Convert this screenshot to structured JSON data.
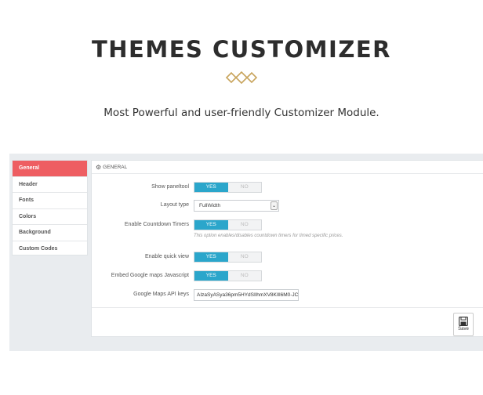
{
  "hero": {
    "title": "THEMES CUSTOMIZER",
    "subtitle": "Most Powerful and user-friendly Customizer Module."
  },
  "colors": {
    "accent_active_tab": "#ee5e62",
    "toggle_on": "#2ba6cb",
    "ornament": "#c8a45c"
  },
  "sidebar": {
    "items": [
      {
        "label": "General",
        "active": true
      },
      {
        "label": "Header",
        "active": false
      },
      {
        "label": "Fonts",
        "active": false
      },
      {
        "label": "Colors",
        "active": false
      },
      {
        "label": "Background",
        "active": false
      },
      {
        "label": "Custom Codes",
        "active": false
      }
    ]
  },
  "panel": {
    "heading_icon": "cog-icon",
    "heading": "GENERAL",
    "fields": {
      "show_paneltool": {
        "label": "Show paneltool",
        "yes": "YES",
        "no": "NO",
        "value": "YES"
      },
      "layout_type": {
        "label": "Layout type",
        "value": "FullWidth"
      },
      "countdown": {
        "label": "Enable Countdown Timers",
        "yes": "YES",
        "no": "NO",
        "value": "YES",
        "help": "This option enables/disables countdown timers for timed specific prices."
      },
      "quick_view": {
        "label": "Enable quick view",
        "yes": "YES",
        "no": "NO",
        "value": "YES"
      },
      "google_maps_js": {
        "label": "Embed Google maps Javascript",
        "yes": "YES",
        "no": "NO",
        "value": "YES"
      },
      "maps_api_key": {
        "label": "Google Maps API keys",
        "value": "AIzaSyASya36pm5HYdSIlhmXV8KlIl6M0-JC"
      }
    },
    "save_label": "Save",
    "save_icon": "floppy-disk-icon"
  }
}
